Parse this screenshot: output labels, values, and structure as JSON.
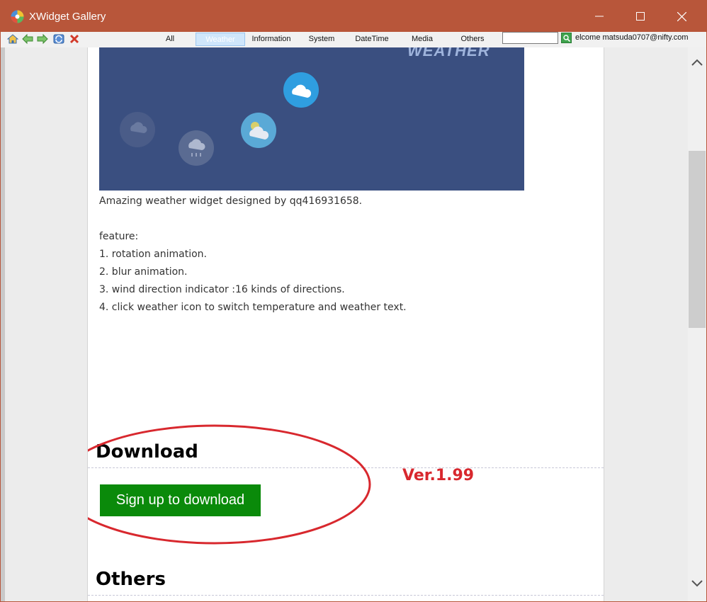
{
  "window": {
    "title": "XWidget Gallery"
  },
  "toolbar": {
    "tabs": [
      {
        "label": "All"
      },
      {
        "label": "Weather"
      },
      {
        "label": "Information"
      },
      {
        "label": "System"
      },
      {
        "label": "DateTime"
      },
      {
        "label": "Media"
      },
      {
        "label": "Others"
      }
    ],
    "active_tab": "Weather",
    "search": {
      "value": "",
      "placeholder": ""
    },
    "welcome_text": "elcome matsuda0707@nifty.com"
  },
  "hero": {
    "overlay_word": "WEATHER"
  },
  "description": {
    "lines": [
      "Amazing weather widget designed by qq416931658.",
      "",
      "feature:",
      "1. rotation animation.",
      "2. blur animation.",
      "3. wind direction indicator :16 kinds of directions.",
      "4. click weather icon to switch temperature and weather text."
    ]
  },
  "download": {
    "heading": "Download",
    "button_label": "Sign up to download",
    "version_annotation": "Ver.1.99"
  },
  "others": {
    "heading": "Others"
  },
  "colors": {
    "titlebar": "#b8563a",
    "hero_bg": "#3a4f80",
    "download_button": "#0a8a0a",
    "annotation_red": "#d8282e"
  }
}
